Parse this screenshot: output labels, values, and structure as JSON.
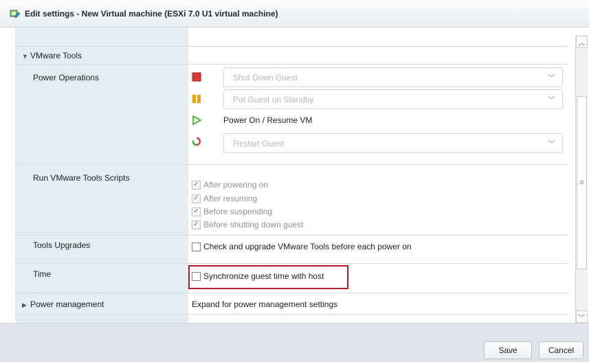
{
  "window": {
    "title": "Edit settings - New Virtual machine (ESXi 7.0 U1 virtual machine)",
    "title_icon": "vm-edit-icon"
  },
  "sections": {
    "vmware_tools": {
      "label": "VMware Tools",
      "expanded": true,
      "power_operations": {
        "label": "Power Operations",
        "items": [
          {
            "icon": "stop-icon",
            "value": "Shut Down Guest",
            "type": "dropdown",
            "enabled": false
          },
          {
            "icon": "pause-icon",
            "value": "Put Guest on Standby",
            "type": "dropdown",
            "enabled": false
          },
          {
            "icon": "play-icon",
            "value": "Power On / Resume VM",
            "type": "text",
            "enabled": true
          },
          {
            "icon": "restart-icon",
            "value": "Restart Guest",
            "type": "dropdown",
            "enabled": false
          }
        ]
      },
      "run_scripts": {
        "label": "Run VMware Tools Scripts",
        "options": [
          {
            "label": "After powering on",
            "checked": true,
            "enabled": false
          },
          {
            "label": "After resuming",
            "checked": true,
            "enabled": false
          },
          {
            "label": "Before suspending",
            "checked": true,
            "enabled": false
          },
          {
            "label": "Before shutting down guest",
            "checked": true,
            "enabled": false
          }
        ]
      },
      "tools_upgrades": {
        "label": "Tools Upgrades",
        "option": "Check and upgrade VMware Tools before each power on",
        "checked": false
      },
      "time": {
        "label": "Time",
        "option": "Synchronize guest time with host",
        "checked": false
      }
    },
    "power_management": {
      "label": "Power management",
      "value": "Expand for power management settings",
      "expanded": false
    }
  },
  "footer": {
    "save_label": "Save",
    "cancel_label": "Cancel"
  },
  "colors": {
    "label_column_bg": "#e2edf5",
    "highlight_border": "#b01e23",
    "footer_bg": "#dfe5ea",
    "stop_red": "#d63a3a",
    "pause_orange": "#f2a20c",
    "play_green": "#3fae2a"
  }
}
